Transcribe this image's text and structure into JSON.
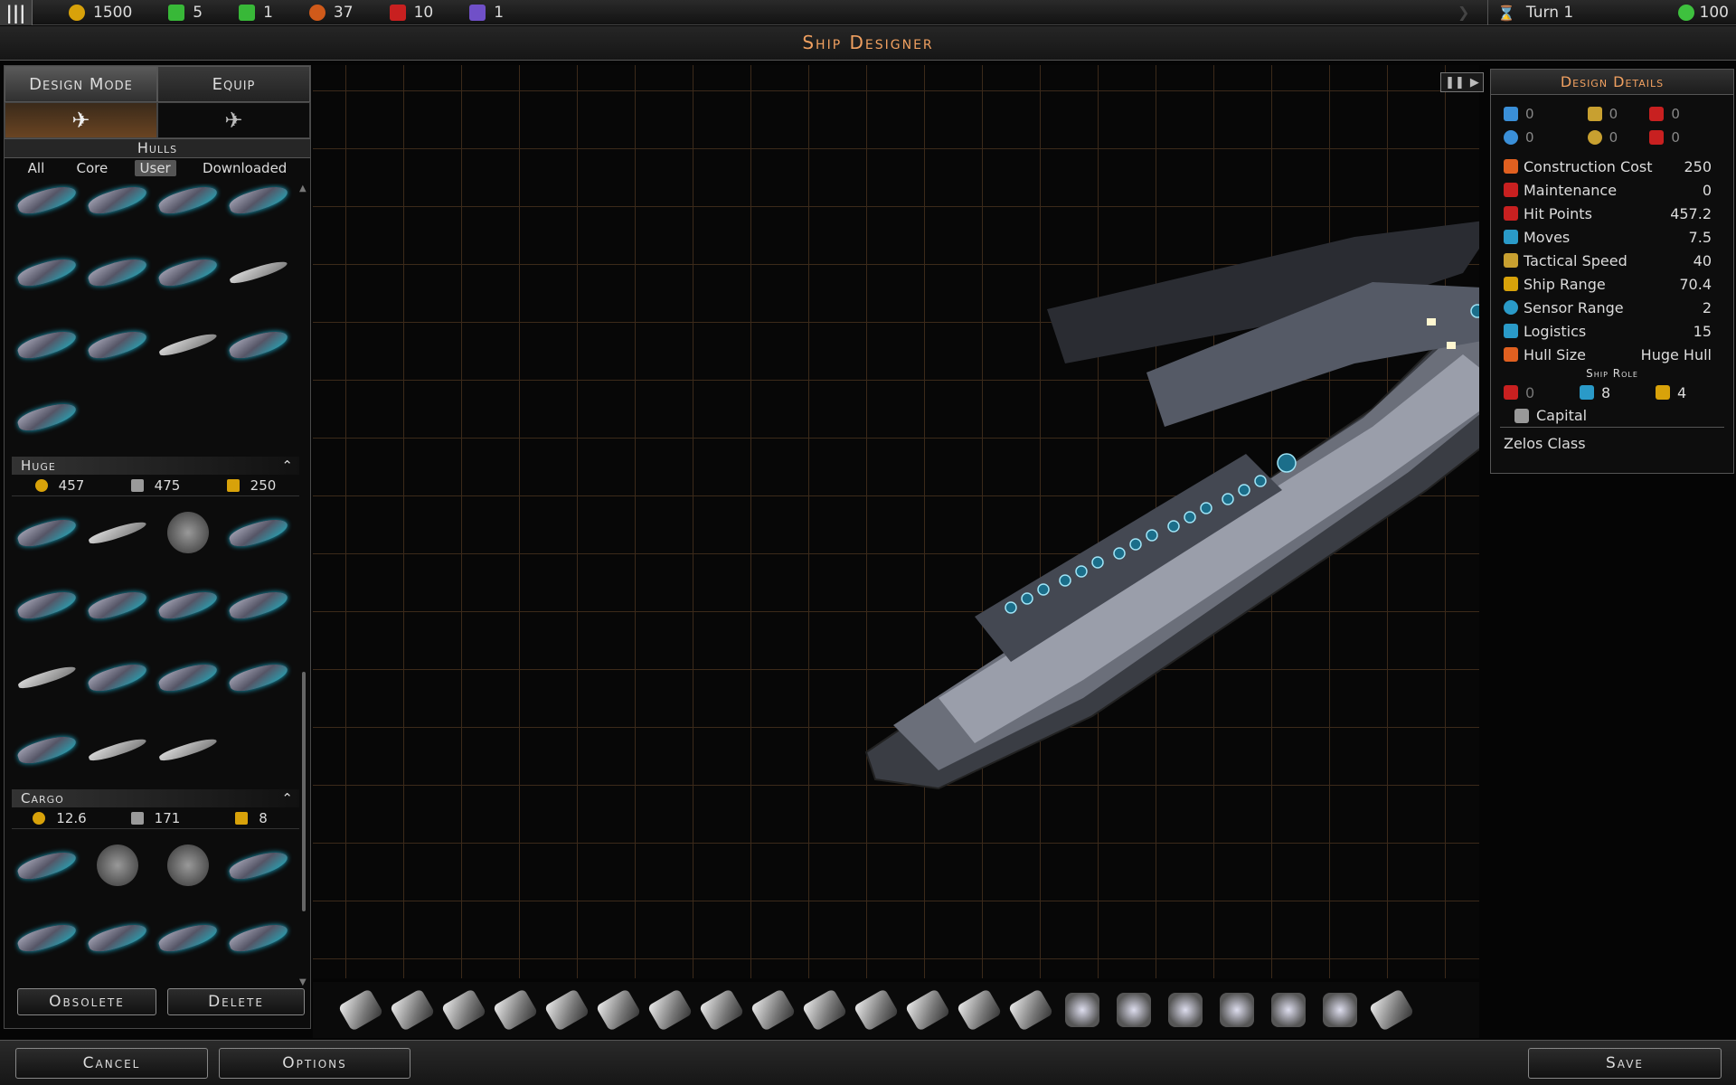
{
  "topbar": {
    "resources": [
      {
        "icon": "credits-icon",
        "value": "1500",
        "color": "#d8a20a"
      },
      {
        "icon": "population-icon",
        "value": "5",
        "color": "#38b838"
      },
      {
        "icon": "food-icon",
        "value": "1",
        "color": "#38b838"
      },
      {
        "icon": "research-icon",
        "value": "37",
        "color": "#d05a1a"
      },
      {
        "icon": "influence-icon",
        "value": "10",
        "color": "#c82020"
      },
      {
        "icon": "promethion-icon",
        "value": "1",
        "color": "#7050c8"
      }
    ],
    "turn": "Turn 1",
    "approval": "100"
  },
  "title": "Ship Designer",
  "left": {
    "tabs": [
      "Design Mode",
      "Equip"
    ],
    "hulls_label": "Hulls",
    "filters": [
      "All",
      "Core",
      "User",
      "Downloaded"
    ],
    "huge": {
      "label": "Huge",
      "stats": [
        "457",
        "475",
        "250"
      ]
    },
    "cargo": {
      "label": "Cargo",
      "stats": [
        "12.6",
        "171",
        "8"
      ]
    },
    "obsolete": "Obsolete",
    "delete": "Delete"
  },
  "details": {
    "title": "Design Details",
    "icon_stats": [
      {
        "icon": "beam-weapon-icon",
        "value": "0",
        "color": "#3a8fd8"
      },
      {
        "icon": "kinetic-weapon-icon",
        "value": "0",
        "color": "#c8a030"
      },
      {
        "icon": "missile-weapon-icon",
        "value": "0",
        "color": "#c82020"
      },
      {
        "icon": "shield-defense-icon",
        "value": "0",
        "color": "#3a8fd8"
      },
      {
        "icon": "point-defense-icon",
        "value": "0",
        "color": "#c8a030"
      },
      {
        "icon": "armor-defense-icon",
        "value": "0",
        "color": "#c82020"
      }
    ],
    "rows": [
      {
        "icon": "construction-cost-icon",
        "label": "Construction Cost",
        "value": "250",
        "color": "#e06020"
      },
      {
        "icon": "maintenance-icon",
        "label": "Maintenance",
        "value": "0",
        "color": "#c82020"
      },
      {
        "icon": "hit-points-icon",
        "label": "Hit Points",
        "value": "457.2",
        "color": "#c82020"
      },
      {
        "icon": "moves-icon",
        "label": "Moves",
        "value": "7.5",
        "color": "#2a9ac8"
      },
      {
        "icon": "tactical-speed-icon",
        "label": "Tactical Speed",
        "value": "40",
        "color": "#c8a030"
      },
      {
        "icon": "ship-range-icon",
        "label": "Ship Range",
        "value": "70.4",
        "color": "#d8a20a"
      },
      {
        "icon": "sensor-range-icon",
        "label": "Sensor Range",
        "value": "2",
        "color": "#2a9ac8"
      },
      {
        "icon": "logistics-icon",
        "label": "Logistics",
        "value": "15",
        "color": "#2a9ac8"
      },
      {
        "icon": "hull-size-icon",
        "label": "Hull Size",
        "value": "Huge Hull",
        "color": "#e06020"
      }
    ],
    "ship_role_label": "Ship Role",
    "role_stats": [
      {
        "icon": "attack-role-icon",
        "value": "0",
        "color": "#c82020"
      },
      {
        "icon": "support-role-icon",
        "value": "8",
        "color": "#2a9ac8"
      },
      {
        "icon": "defense-role-icon",
        "value": "4",
        "color": "#d8a20a"
      }
    ],
    "role": "Capital",
    "class_name": "Zelos Class"
  },
  "footer": {
    "cancel": "Cancel",
    "options": "Options",
    "save": "Save"
  }
}
